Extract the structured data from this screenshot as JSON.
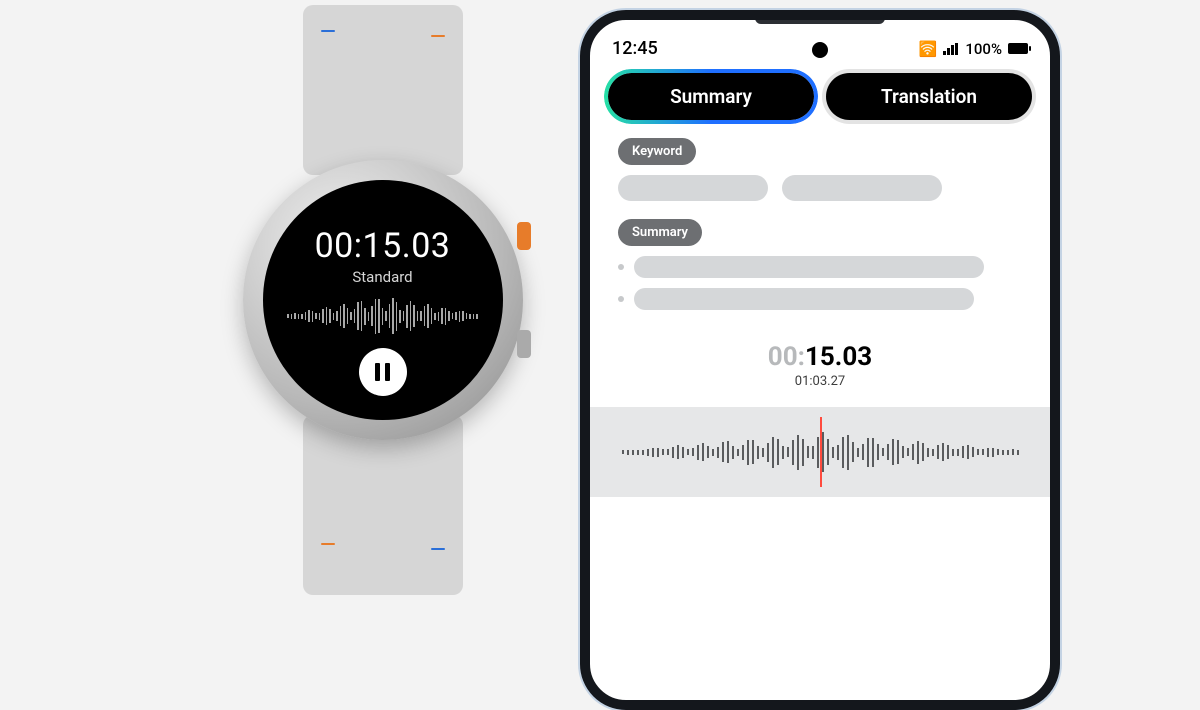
{
  "watch": {
    "time": "00:15.03",
    "mode": "Standard",
    "icon": "pause"
  },
  "phone": {
    "status": {
      "clock": "12:45",
      "battery_text": "100%"
    },
    "tabs": {
      "summary": "Summary",
      "translation": "Translation",
      "active": "summary"
    },
    "sections": {
      "keyword_label": "Keyword",
      "summary_label": "Summary"
    },
    "timeline": {
      "current_dim": "00:",
      "current_rest": "15.03",
      "total": "01:03.27"
    }
  }
}
